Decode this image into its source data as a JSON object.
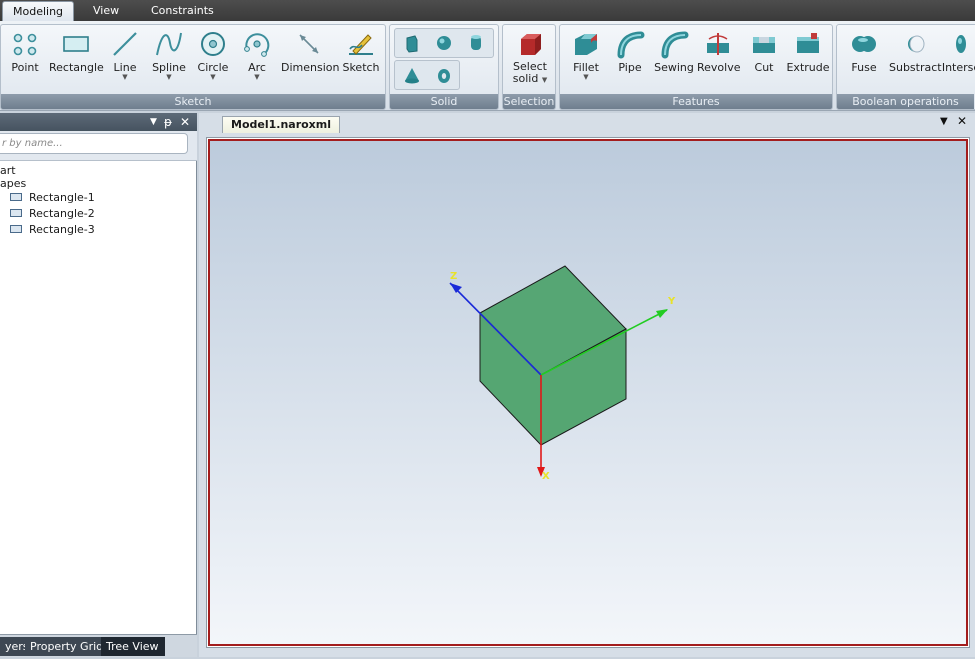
{
  "menu": {
    "tabs": [
      {
        "label": "Modeling",
        "active": true
      },
      {
        "label": "View",
        "active": false
      },
      {
        "label": "Constraints",
        "active": false
      }
    ]
  },
  "ribbon": {
    "sketch": {
      "label": "Sketch",
      "tools": [
        {
          "label": "Point",
          "icon": "point-icon",
          "dropdown": false
        },
        {
          "label": "Rectangle",
          "icon": "rectangle-icon",
          "dropdown": false
        },
        {
          "label": "Line",
          "icon": "line-icon",
          "dropdown": true
        },
        {
          "label": "Spline",
          "icon": "spline-icon",
          "dropdown": true
        },
        {
          "label": "Circle",
          "icon": "circle-icon",
          "dropdown": true
        },
        {
          "label": "Arc",
          "icon": "arc-icon",
          "dropdown": true
        },
        {
          "label": "Dimension",
          "icon": "dimension-icon",
          "dropdown": false
        },
        {
          "label": "Sketch",
          "icon": "sketch-icon",
          "dropdown": false
        }
      ]
    },
    "solid": {
      "label": "Solid",
      "buttons": [
        "box-icon",
        "sphere-icon",
        "cylinder-icon",
        "cone-icon",
        "torus-icon"
      ]
    },
    "selection": {
      "label": "Selection",
      "select_solid_line1": "Select",
      "select_solid_line2": "solid"
    },
    "features": {
      "label": "Features",
      "tools": [
        {
          "label": "Fillet",
          "icon": "fillet-icon",
          "dropdown": true
        },
        {
          "label": "Pipe",
          "icon": "pipe-icon",
          "dropdown": false
        },
        {
          "label": "Sewing",
          "icon": "sewing-icon",
          "dropdown": false
        },
        {
          "label": "Revolve",
          "icon": "revolve-icon",
          "dropdown": false
        },
        {
          "label": "Cut",
          "icon": "cut-icon",
          "dropdown": false
        },
        {
          "label": "Extrude",
          "icon": "extrude-icon",
          "dropdown": false
        }
      ]
    },
    "boolean": {
      "label": "Boolean operations",
      "tools": [
        {
          "label": "Fuse",
          "icon": "fuse-icon"
        },
        {
          "label": "Substract",
          "icon": "substract-icon"
        },
        {
          "label": "Interse",
          "icon": "intersect-icon"
        }
      ]
    }
  },
  "left_panel": {
    "filter_placeholder": "r by name...",
    "tree": {
      "root": "art",
      "group": "apes",
      "items": [
        "Rectangle-1",
        "Rectangle-2",
        "Rectangle-3"
      ]
    },
    "tabs": [
      {
        "label": "yers",
        "active": false
      },
      {
        "label": "Property Grid",
        "active": false
      },
      {
        "label": "Tree View",
        "active": true
      }
    ]
  },
  "document": {
    "tab_title": "Model1.naroxml",
    "axes": {
      "x": "X",
      "y": "Y",
      "z": "Z"
    },
    "colors": {
      "cube_face": "#55a672",
      "x_axis": "#e01818",
      "y_axis": "#22cc22",
      "z_axis": "#1a2ad8",
      "axis_label": "#e8e22a",
      "frame": "#a31d1d"
    }
  }
}
